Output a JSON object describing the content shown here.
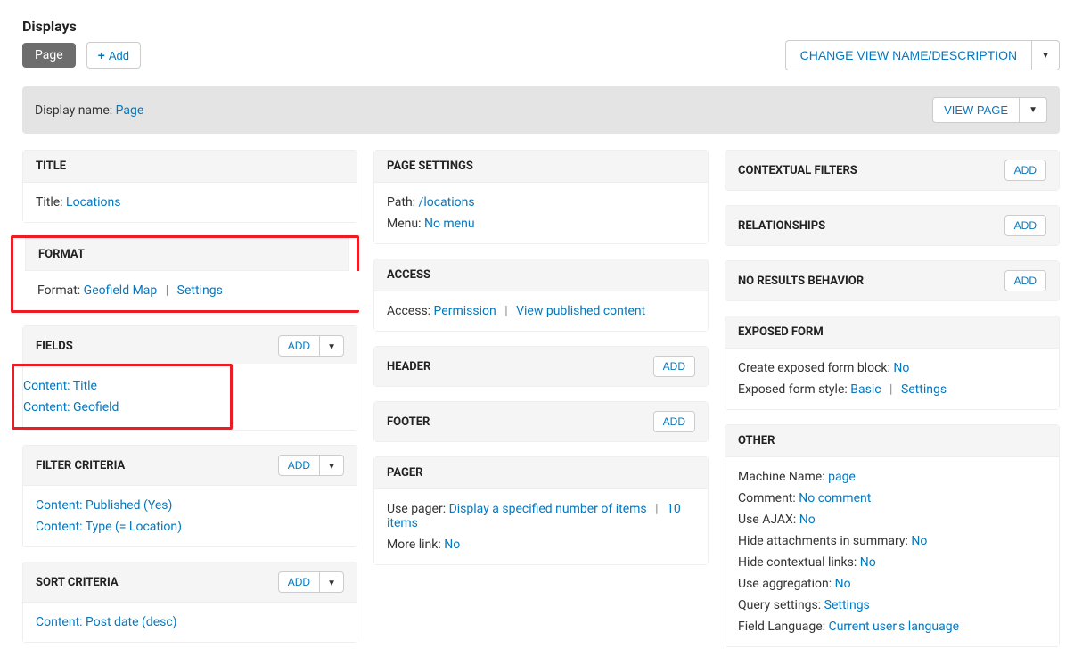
{
  "displays": {
    "heading": "Displays",
    "page_tab": "Page",
    "add_button": "Add",
    "change_view_button": "CHANGE VIEW NAME/DESCRIPTION"
  },
  "display_name_bar": {
    "label": "Display name:",
    "value": "Page",
    "view_page_button": "VIEW PAGE"
  },
  "col1": {
    "title_panel": {
      "heading": "TITLE",
      "title_label": "Title:",
      "title_value": "Locations"
    },
    "format_panel": {
      "heading": "FORMAT",
      "format_label": "Format:",
      "format_value": "Geofield Map",
      "settings_link": "Settings"
    },
    "fields_panel": {
      "heading": "FIELDS",
      "add_button": "ADD",
      "items": [
        "Content: Title",
        "Content: Geofield"
      ]
    },
    "filter_panel": {
      "heading": "FILTER CRITERIA",
      "add_button": "ADD",
      "items": [
        "Content: Published (Yes)",
        "Content: Type (= Location)"
      ]
    },
    "sort_panel": {
      "heading": "SORT CRITERIA",
      "add_button": "ADD",
      "items": [
        "Content: Post date (desc)"
      ]
    }
  },
  "col2": {
    "page_settings": {
      "heading": "PAGE SETTINGS",
      "path_label": "Path:",
      "path_value": "/locations",
      "menu_label": "Menu:",
      "menu_value": "No menu"
    },
    "access": {
      "heading": "ACCESS",
      "access_label": "Access:",
      "access_value": "Permission",
      "access_detail": "View published content"
    },
    "header": {
      "heading": "HEADER",
      "add_button": "ADD"
    },
    "footer": {
      "heading": "FOOTER",
      "add_button": "ADD"
    },
    "pager": {
      "heading": "PAGER",
      "use_pager_label": "Use pager:",
      "use_pager_value": "Display a specified number of items",
      "items_value": "10 items",
      "more_link_label": "More link:",
      "more_link_value": "No"
    }
  },
  "col3": {
    "contextual_filters": {
      "heading": "CONTEXTUAL FILTERS",
      "add_button": "ADD"
    },
    "relationships": {
      "heading": "RELATIONSHIPS",
      "add_button": "ADD"
    },
    "no_results": {
      "heading": "NO RESULTS BEHAVIOR",
      "add_button": "ADD"
    },
    "exposed_form": {
      "heading": "EXPOSED FORM",
      "create_label": "Create exposed form block:",
      "create_value": "No",
      "style_label": "Exposed form style:",
      "style_value": "Basic",
      "settings_link": "Settings"
    },
    "other": {
      "heading": "OTHER",
      "machine_name_label": "Machine Name:",
      "machine_name_value": "page",
      "comment_label": "Comment:",
      "comment_value": "No comment",
      "use_ajax_label": "Use AJAX:",
      "use_ajax_value": "No",
      "hide_attach_label": "Hide attachments in summary:",
      "hide_attach_value": "No",
      "hide_ctx_label": "Hide contextual links:",
      "hide_ctx_value": "No",
      "use_agg_label": "Use aggregation:",
      "use_agg_value": "No",
      "query_label": "Query settings:",
      "query_value": "Settings",
      "field_lang_label": "Field Language:",
      "field_lang_value": "Current user's language"
    }
  },
  "caret": "▼"
}
